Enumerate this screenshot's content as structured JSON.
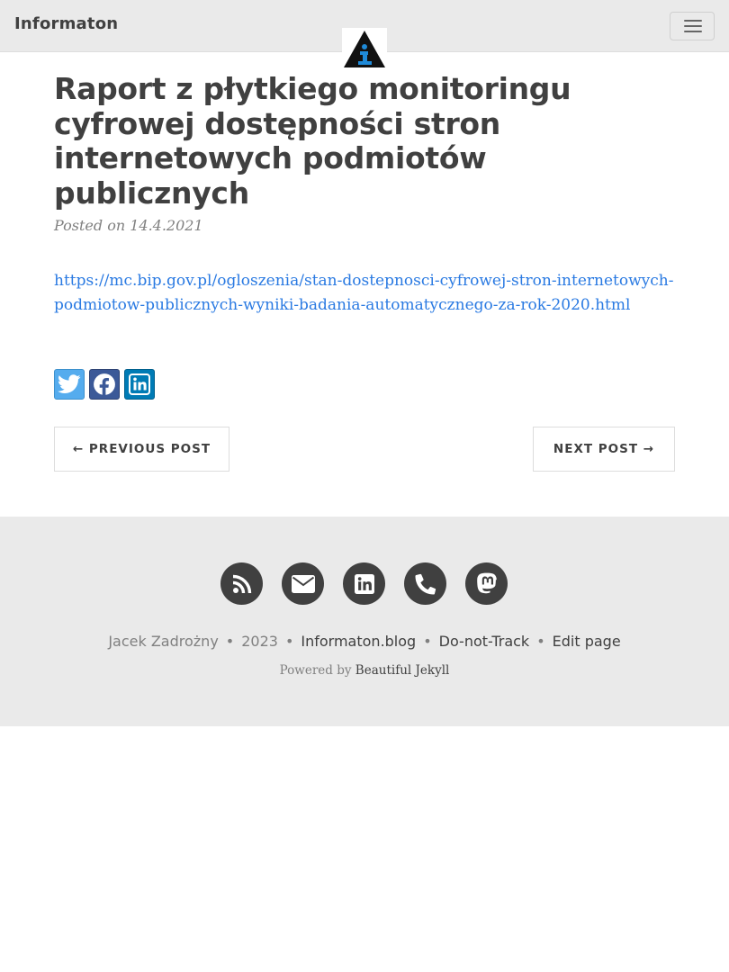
{
  "navbar": {
    "brand": "Informaton",
    "toggle_icon": "hamburger-menu-icon",
    "avatar_icon": "info-triangle-logo-icon",
    "colors": {
      "background": "#eaeaea",
      "logo_blue": "#1f8ad8"
    }
  },
  "post": {
    "title": "Raport z płytkiego monitoringu cyfrowej dostępności stron internetowych podmiotów publicznych",
    "meta": "Posted on 14.4.2021",
    "link": "https://mc.bip.gov.pl/ogloszenia/stan-dostepnosci-cyfrowej-stron-internetowych-podmiotow-publicznych-wyniki-badania-automatycznego-za-rok-2020.html"
  },
  "share": [
    {
      "icon": "twitter-icon",
      "color": "#55acee"
    },
    {
      "icon": "facebook-icon",
      "color": "#3b5998"
    },
    {
      "icon": "linkedin-icon",
      "color": "#007bb5"
    }
  ],
  "pager": {
    "previous": "← PREVIOUS POST",
    "next": "NEXT POST →"
  },
  "footer": {
    "social_icons": [
      "rss-icon",
      "envelope-icon",
      "linkedin-icon",
      "phone-icon",
      "mastodon-icon"
    ],
    "author": "Jacek Zadrożny",
    "year": "2023",
    "site": "Informaton.blog",
    "dnt": "Do-not-Track",
    "edit": "Edit page",
    "separator": "•",
    "powered_prefix": "Powered by",
    "powered_theme": "Beautiful Jekyll",
    "colors": {
      "background": "#eaeaea",
      "icon_circle": "#404040"
    }
  }
}
